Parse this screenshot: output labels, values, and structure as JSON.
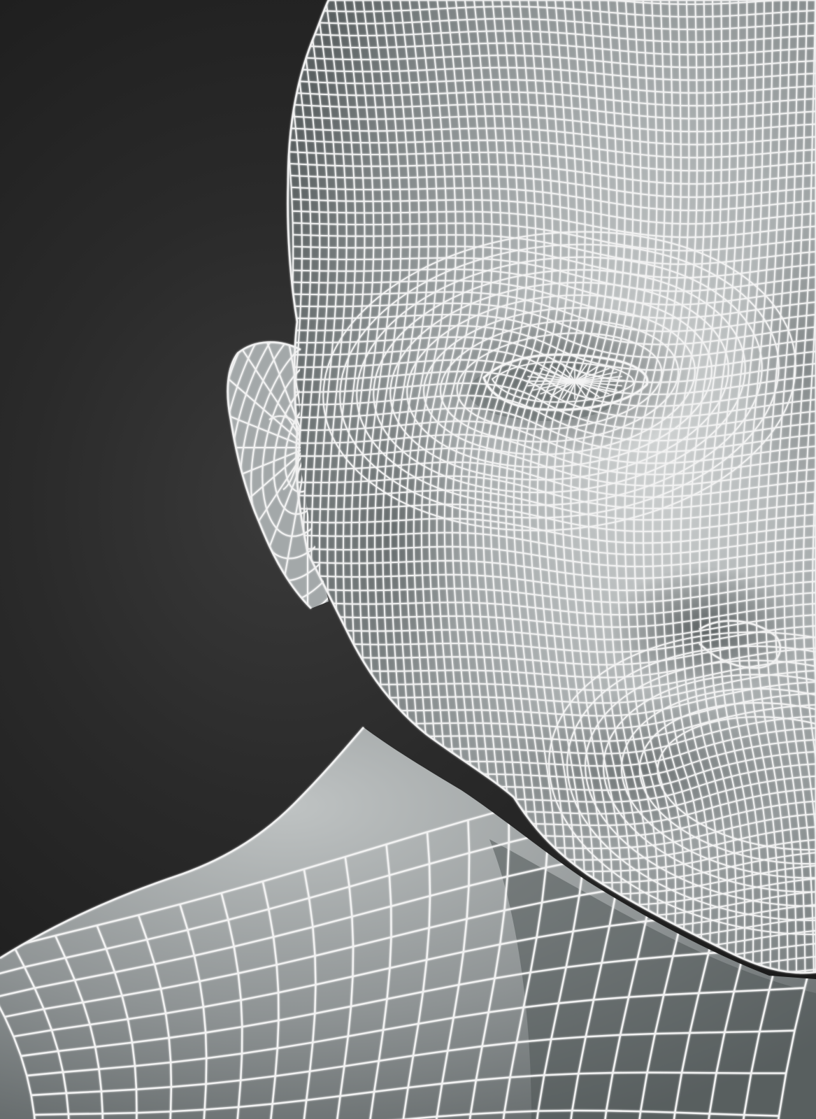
{
  "scene": {
    "subject": "wireframe-head-bust",
    "colors": {
      "background_center": "#3a3a3a",
      "background_edge": "#181818",
      "skin_light": "#c9cccc",
      "skin_mid": "#9da2a3",
      "skin_dark": "#5f6566",
      "wire": "#f2f2f2"
    }
  }
}
